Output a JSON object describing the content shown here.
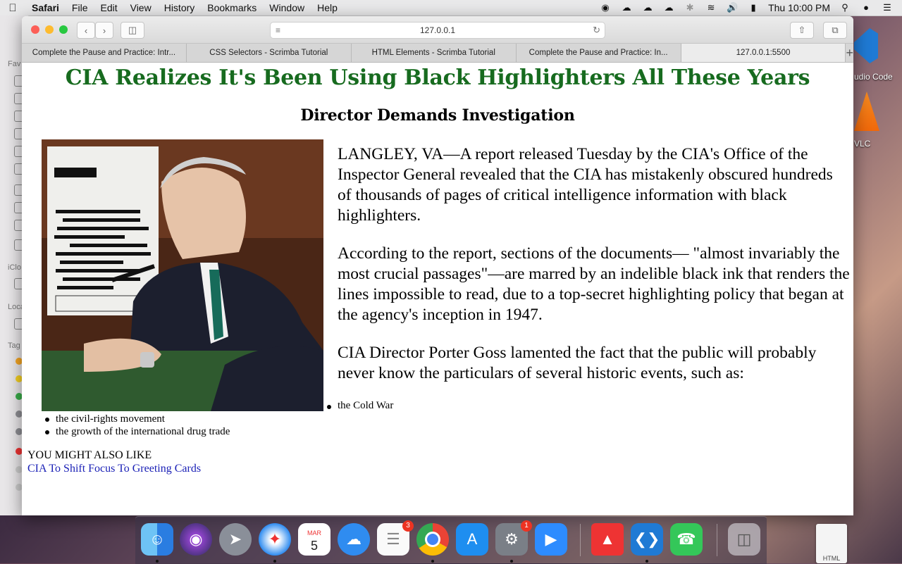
{
  "menubar": {
    "apple": "",
    "app_name": "Safari",
    "items": [
      "File",
      "Edit",
      "View",
      "History",
      "Bookmarks",
      "Window",
      "Help"
    ],
    "clock": "Thu 10:00 PM"
  },
  "finder_sidebar": {
    "favorites_label": "Fav",
    "icloud_label": "iClo",
    "locations_label": "Loca",
    "tags_label": "Tag"
  },
  "desktop": {
    "vscode_label": "udio Code",
    "vlc_label": "VLC",
    "html_file_label": "HTML"
  },
  "safari": {
    "url": "127.0.0.1",
    "tabs": [
      {
        "label": "Complete the Pause and Practice: Intr..."
      },
      {
        "label": "CSS Selectors - Scrimba Tutorial"
      },
      {
        "label": "HTML Elements - Scrimba Tutorial"
      },
      {
        "label": "Complete the Pause and Practice: In..."
      },
      {
        "label": "127.0.0.1:5500"
      }
    ]
  },
  "article": {
    "headline": "CIA Realizes It's Been Using Black Highlighters All These Years",
    "subheadline": "Director Demands Investigation",
    "paragraphs": [
      "LANGLEY, VA—A report released Tuesday by the CIA's Office of the Inspector General revealed that the CIA has mistakenly obscured hundreds of thousands of pages of critical intelligence information with black highlighters.",
      "According to the report, sections of the documents— \"almost invariably the most crucial passages\"—are marred by an indelible black ink that renders the lines impossible to read, due to a top-secret highlighting policy that began at the agency's inception in 1947.",
      "CIA Director Porter Goss lamented the fact that the public will probably never know the particulars of several historic events, such as:"
    ],
    "list_items": [
      "the Cold War",
      "the civil-rights movement",
      "the growth of the international drug trade"
    ],
    "also_like_label": "YOU MIGHT ALSO LIKE",
    "also_like_link": "CIA To Shift Focus To Greeting Cards"
  },
  "dock": {
    "items": [
      {
        "name": "finder"
      },
      {
        "name": "siri"
      },
      {
        "name": "launchpad"
      },
      {
        "name": "safari"
      },
      {
        "name": "calendar",
        "month": "MAR",
        "day": "5"
      },
      {
        "name": "upload"
      },
      {
        "name": "reminders",
        "badge": "3"
      },
      {
        "name": "chrome"
      },
      {
        "name": "app-store"
      },
      {
        "name": "system-preferences",
        "badge": "1"
      },
      {
        "name": "zoom"
      },
      {
        "name": "popcorn-time"
      },
      {
        "name": "vscode"
      },
      {
        "name": "facetime"
      },
      {
        "name": "trash"
      }
    ]
  }
}
